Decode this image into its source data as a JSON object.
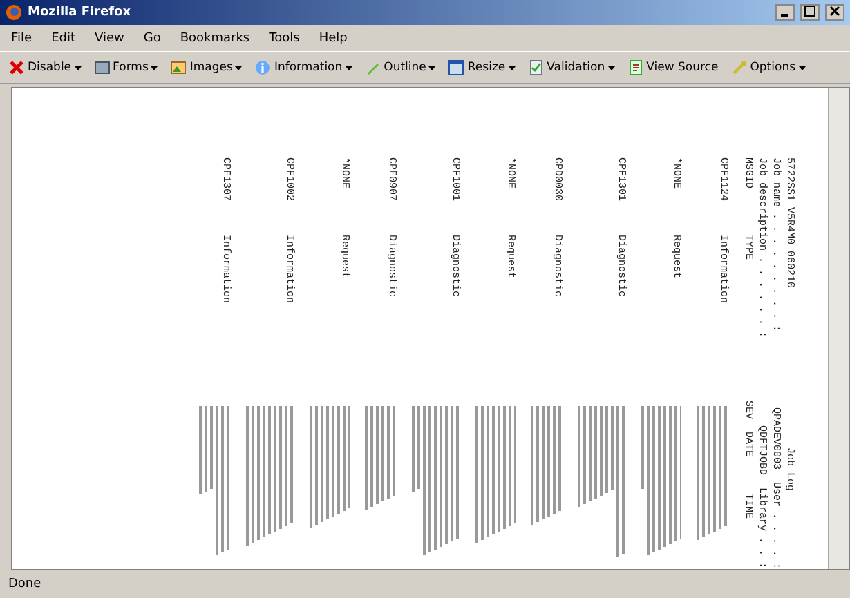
{
  "window": {
    "title": "Mozilla Firefox"
  },
  "menu": [
    {
      "label": "File"
    },
    {
      "label": "Edit"
    },
    {
      "label": "View"
    },
    {
      "label": "Go"
    },
    {
      "label": "Bookmarks"
    },
    {
      "label": "Tools"
    },
    {
      "label": "Help"
    }
  ],
  "toolbar": [
    {
      "label": "Disable",
      "dropdown": true
    },
    {
      "label": "Forms",
      "dropdown": true
    },
    {
      "label": "Images",
      "dropdown": true
    },
    {
      "label": "Information",
      "dropdown": true
    },
    {
      "label": "Outline",
      "dropdown": true
    },
    {
      "label": "Resize",
      "dropdown": true
    },
    {
      "label": "Validation",
      "dropdown": true
    },
    {
      "label": "View Source",
      "dropdown": false
    },
    {
      "label": "Options",
      "dropdown": true
    }
  ],
  "page": {
    "header": [
      {
        "left": "5722SS1 V5R4M0 060210",
        "right": "Job Log"
      },
      {
        "left": "Job name . . . . . . . . . :",
        "right": "QPADEV0003  User . . . . :"
      },
      {
        "left": "Job description . . . . . . :",
        "right": "QDFTJOBD  Library . . :"
      }
    ],
    "columns": [
      "MSGID",
      "TYPE",
      "SEV  DATE      TIME"
    ],
    "rows": [
      {
        "msgid": "CPF1124",
        "type": "Information"
      },
      {
        "msgid": "*NONE",
        "type": "Request"
      },
      {
        "msgid": "CPF1301",
        "type": "Diagnostic"
      },
      {
        "msgid": "CPD0030",
        "type": "Diagnostic"
      },
      {
        "msgid": "*NONE",
        "type": "Request"
      },
      {
        "msgid": "CPF1001",
        "type": "Diagnostic"
      },
      {
        "msgid": "CPF0907",
        "type": "Diagnostic"
      },
      {
        "msgid": "*NONE",
        "type": "Request"
      },
      {
        "msgid": "CPF1002",
        "type": "Information"
      },
      {
        "msgid": "CPF1307",
        "type": "Information"
      }
    ]
  },
  "status_bar": {
    "text": "Done"
  }
}
